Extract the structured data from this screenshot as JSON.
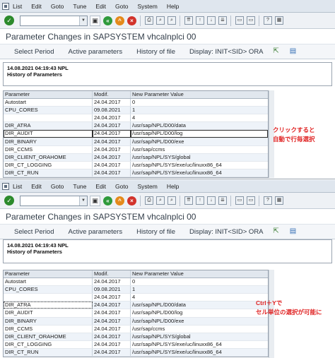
{
  "menu": [
    "List",
    "Edit",
    "Goto",
    "Tune",
    "Edit",
    "Goto",
    "System",
    "Help"
  ],
  "menu_2": [
    "List",
    "Edit",
    "Goto",
    "Tune",
    "Edit",
    "Goto",
    "System",
    "Help"
  ],
  "title": "Parameter Changes in SAPSYSTEM vhcalnplci 00",
  "app_buttons": {
    "select_period": "Select Period",
    "active_parameters": "Active parameters",
    "history_of_file": "History of file",
    "display": "Display: INIT<SID> ORA"
  },
  "header": {
    "line1": "14.08.2021  04:19:43  NPL",
    "line2": "History of Parameters"
  },
  "columns": [
    "Parameter",
    "Modif.",
    "New Parameter Value"
  ],
  "rows": [
    [
      "Autostart",
      "24.04.2017",
      "0"
    ],
    [
      "CPU_CORES",
      "09.08.2021",
      "1"
    ],
    [
      "",
      "24.04.2017",
      "4"
    ],
    [
      "DIR_ATRA",
      "24.04.2017",
      "/usr/sap/NPL/D00/data"
    ],
    [
      "DIR_AUDIT",
      "24.04.2017",
      "/usr/sap/NPL/D00/log"
    ],
    [
      "DIR_BINARY",
      "24.04.2017",
      "/usr/sap/NPL/D00/exe"
    ],
    [
      "DIR_CCMS",
      "24.04.2017",
      "/usr/sap/ccms"
    ],
    [
      "DIR_CLIENT_ORAHOME",
      "24.04.2017",
      "/usr/sap/NPL/SYS/global"
    ],
    [
      "DIR_CT_LOGGING",
      "24.04.2017",
      "/usr/sap/NPL/SYS/exe/uc/linuxx86_64"
    ],
    [
      "DIR_CT_RUN",
      "24.04.2017",
      "/usr/sap/NPL/SYS/exe/uc/linuxx86_64"
    ]
  ],
  "notes": {
    "top_line1": "クリックすると",
    "top_line2": "自動で行毎選択",
    "bottom_line1": "Ctrl＋Yで",
    "bottom_line2": "セル単位の選択が可能に"
  },
  "colors": {
    "annotation": "#e02424",
    "menubar": "#dfe6ee",
    "grid_header": "#e1e7ee"
  }
}
